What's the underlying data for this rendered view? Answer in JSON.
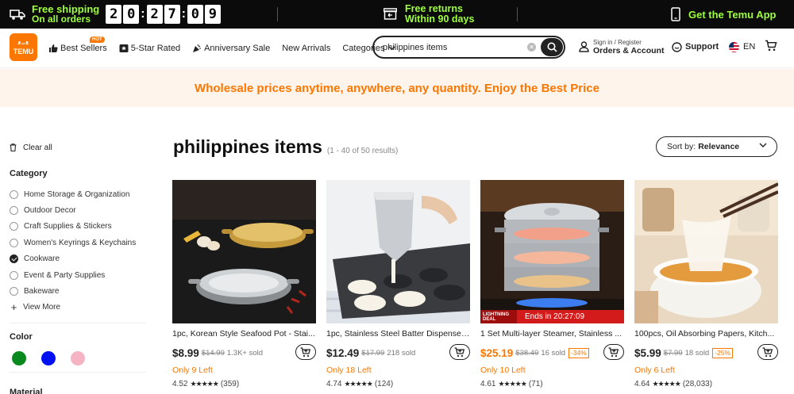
{
  "topbar": {
    "shipping_line1": "Free shipping",
    "shipping_line2": "On all orders",
    "timer": [
      "2",
      "0",
      "2",
      "7",
      "0",
      "9"
    ],
    "returns_line1": "Free returns",
    "returns_line2": "Within 90 days",
    "app_label": "Get the Temu App",
    "accent_color": "#9dff3c"
  },
  "header": {
    "logo_line1": "ᴥᴗᴥ",
    "logo_line2": "TEMU",
    "nav": [
      {
        "label": "Best Sellers",
        "icon": "thumbs-up-icon",
        "badge": "HOT"
      },
      {
        "label": "5-Star Rated",
        "icon": "star-badge-icon"
      },
      {
        "label": "Anniversary Sale",
        "icon": "party-icon"
      },
      {
        "label": "New Arrivals"
      },
      {
        "label": "Categories",
        "icon": "chevron-down-icon"
      }
    ],
    "search_query": "philippines items",
    "account_line1": "Sign in / Register",
    "account_line2": "Orders & Account",
    "support": "Support",
    "language": "EN"
  },
  "banner": {
    "text": "Wholesale prices anytime, anywhere, any quantity. Enjoy the Best Price"
  },
  "sidebar": {
    "clear_all": "Clear all",
    "category_title": "Category",
    "categories": [
      {
        "label": "Home Storage & Organization",
        "checked": false
      },
      {
        "label": "Outdoor Decor",
        "checked": false
      },
      {
        "label": "Craft Supplies & Stickers",
        "checked": false
      },
      {
        "label": "Women's Keyrings & Keychains",
        "checked": false
      },
      {
        "label": "Cookware",
        "checked": true
      },
      {
        "label": "Event & Party Supplies",
        "checked": false
      },
      {
        "label": "Bakeware",
        "checked": false
      }
    ],
    "view_more": "View More",
    "color_title": "Color",
    "colors": [
      "#0a8a1e",
      "#0010f0",
      "#f6b3c3"
    ],
    "material_title": "Material"
  },
  "main": {
    "title": "philippines items",
    "result_count": "(1 - 40 of 50 results)",
    "sort_prefix": "Sort by:",
    "sort_value": "Relevance"
  },
  "products": [
    {
      "title": "1pc, Korean Style Seafood Pot - Stai...",
      "price": "$8.99",
      "orig": "$14.99",
      "sold": "1.3K+ sold",
      "discount": "",
      "left": "Only 9 Left",
      "rating": "4.52",
      "reviews": "(359)",
      "sale": false
    },
    {
      "title": "1pc, Stainless Steel Batter Dispenser...",
      "price": "$12.49",
      "orig": "$17.99",
      "sold": "218 sold",
      "discount": "",
      "left": "Only 18 Left",
      "rating": "4.74",
      "reviews": "(124)",
      "sale": false
    },
    {
      "title": "1 Set Multi-layer Steamer, Stainless ...",
      "price": "$25.19",
      "orig": "$38.49",
      "sold": "16 sold",
      "discount": "-34%",
      "left": "Only 10 Left",
      "rating": "4.61",
      "reviews": "(71)",
      "sale": true,
      "lightning_tag": "LIGHTNING DEAL",
      "lightning_ends": "Ends in 20:27:09"
    },
    {
      "title": "100pcs, Oil Absorbing Papers, Kitch...",
      "price": "$5.99",
      "orig": "$7.99",
      "sold": "18 sold",
      "discount": "-25%",
      "left": "Only 6 Left",
      "rating": "4.64",
      "reviews": "(28,033)",
      "sale": false
    }
  ],
  "stars_glyph": "★★★★★"
}
